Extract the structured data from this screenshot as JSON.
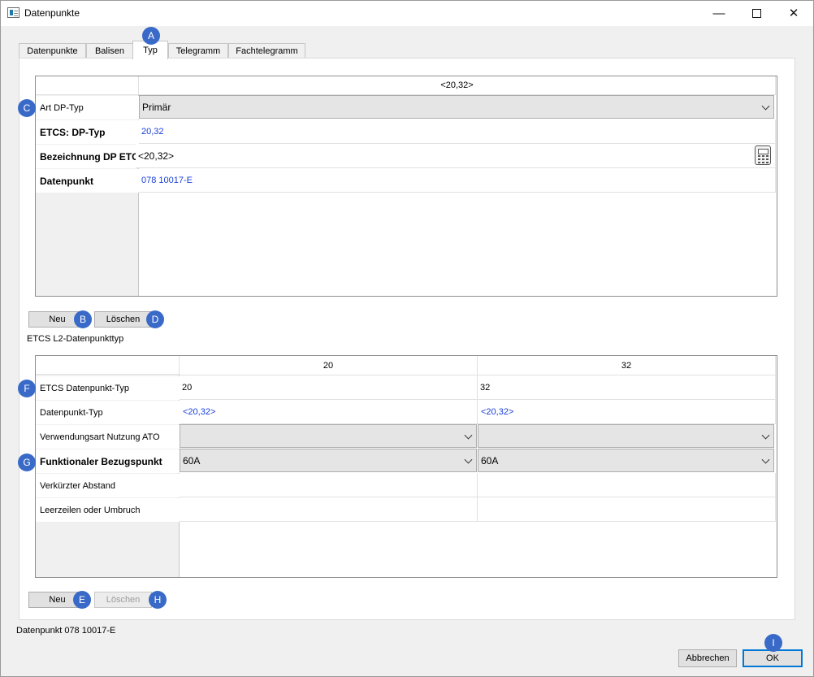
{
  "window": {
    "title": "Datenpunkte"
  },
  "tabs": [
    "Datenpunkte",
    "Balisen",
    "Typ",
    "Telegramm",
    "Fachtelegramm"
  ],
  "upper": {
    "column_header": "<20,32>",
    "rows": [
      {
        "label": "Art DP-Typ",
        "value": "Primär"
      },
      {
        "label": "ETCS: DP-Typ",
        "value": "20,32"
      },
      {
        "label": "Bezeichnung DP ETCS",
        "value": "<20,32>"
      },
      {
        "label": "Datenpunkt",
        "value": "078 10017-E"
      }
    ],
    "new_label": "Neu",
    "delete_label": "Löschen"
  },
  "section_label": "ETCS L2-Datenpunkttyp",
  "lower": {
    "columns": [
      "20",
      "32"
    ],
    "rows": [
      {
        "label": "ETCS Datenpunkt-Typ",
        "values": [
          "20",
          "32"
        ]
      },
      {
        "label": "Datenpunkt-Typ",
        "values": [
          "<20,32>",
          "<20,32>"
        ]
      },
      {
        "label": "Verwendungsart Nutzung ATO",
        "values": [
          "",
          ""
        ]
      },
      {
        "label": "Funktionaler Bezugspunkt",
        "values": [
          "60A",
          "60A"
        ]
      },
      {
        "label": "Verkürzter Abstand",
        "values": [
          "",
          ""
        ]
      },
      {
        "label": "Leerzeilen oder Umbruch",
        "values": [
          "",
          ""
        ]
      }
    ],
    "new_label": "Neu",
    "delete_label": "Löschen"
  },
  "status": "Datenpunkt 078 10017-E",
  "footer": {
    "cancel_label": "Abbrechen",
    "ok_label": "OK"
  },
  "badges": {
    "a": "A",
    "b": "B",
    "c": "C",
    "d": "D",
    "e": "E",
    "f": "F",
    "g": "G",
    "h": "H",
    "i": "I"
  },
  "colors": {
    "link_blue": "#1a3fd8",
    "badge": "#3a6ac8",
    "focus": "#0078d7"
  }
}
